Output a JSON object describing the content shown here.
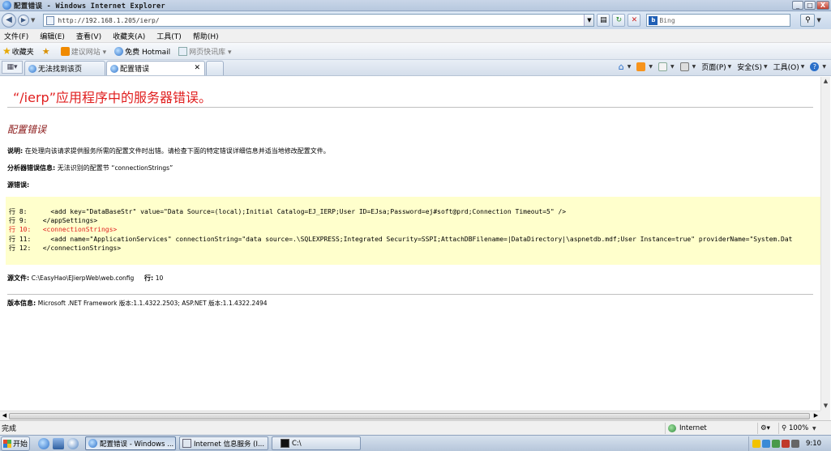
{
  "window": {
    "title": "配置错误 - Windows Internet Explorer",
    "minimize": "_",
    "maximize": "□",
    "close": "X"
  },
  "address_bar": {
    "back": "◀",
    "forward": "▶",
    "url": "http://192.168.1.205/ierp/",
    "search_placeholder": "Bing",
    "search_logo": "b"
  },
  "menu": {
    "items": [
      "文件(F)",
      "编辑(E)",
      "查看(V)",
      "收藏夹(A)",
      "工具(T)",
      "帮助(H)"
    ]
  },
  "favorites_bar": {
    "favorites_label": "收藏夹",
    "items": [
      "建议网站 ▾",
      "免费 Hotmail",
      "网页快讯库 ▾"
    ]
  },
  "tabs": {
    "items": [
      "无法找到该页",
      "配置错误"
    ]
  },
  "command_bar": {
    "page": "页面(P)",
    "safety": "安全(S)",
    "tools": "工具(O)",
    "help": "?"
  },
  "page": {
    "heading": "“/ierp”应用程序中的服务器错误。",
    "subheading": "配置错误",
    "description_label": "说明:",
    "description_text": "在处理向该请求提供服务所需的配置文件时出错。请检查下面的特定错误详细信息并适当地修改配置文件。",
    "parser_label": "分析器错误信息:",
    "parser_text": "无法识别的配置节 “",
    "parser_value": "connectionStrings",
    "parser_end": "”",
    "source_error_label": "源错误:",
    "source_lines": [
      {
        "text": "行 8:      <add key=\"DataBaseStr\" value=\"Data Source=(local);Initial Catalog=EJ_IERP;User ID=EJsa;Password=ej#soft@prd;Connection Timeout=5\" />",
        "error": false
      },
      {
        "text": "行 9:    </appSettings>",
        "error": false
      },
      {
        "text": "行 10:   <connectionStrings>",
        "error": true
      },
      {
        "text": "行 11:     <add name=\"ApplicationServices\" connectionString=\"data source=.\\SQLEXPRESS;Integrated Security=SSPI;AttachDBFilename=|DataDirectory|\\aspnetdb.mdf;User Instance=true\" providerName=\"System.Dat",
        "error": false
      },
      {
        "text": "行 12:   </connectionStrings>",
        "error": false
      }
    ],
    "source_file_label": "源文件:",
    "source_file_value": "C:\\EasyHao\\EJierpWeb\\web.config",
    "line_label": "行:",
    "line_value": "10",
    "version_label": "版本信息:",
    "version_text_1": "Microsoft .NET Framework 版本:",
    "version_value_1": "1.1.4322.2503",
    "version_text_2": "; ASP.NET 版本:",
    "version_value_2": "1.1.4322.2494"
  },
  "status_bar": {
    "status": "完成",
    "zone": "Internet",
    "zoom": "100%"
  },
  "taskbar": {
    "start": "开始",
    "buttons": [
      "配置错误 - Windows ...",
      "Internet 信息服务 (I...",
      "C:\\"
    ],
    "clock": "9:10"
  }
}
